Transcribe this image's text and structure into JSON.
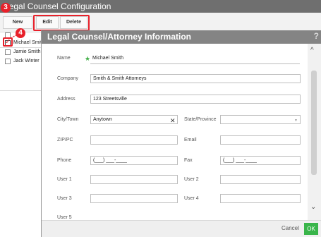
{
  "background": {
    "window_title": "Legal Counsel Configuration",
    "toolbar": {
      "new_label": "New",
      "edit_label": "Edit",
      "delete_label": "Delete"
    },
    "step_badges": [
      "3",
      "4"
    ],
    "rows": [
      {
        "name": "",
        "checked": false
      },
      {
        "name": "Michael Smith",
        "checked": true
      },
      {
        "name": "Jamie Smith",
        "checked": false
      },
      {
        "name": "Jack Winter",
        "checked": false
      }
    ]
  },
  "modal": {
    "title": "Legal Counsel/Attorney Information",
    "help_icon": "?",
    "fields": {
      "name": {
        "label": "Name",
        "value": "Michael Smith",
        "required_icon": "★"
      },
      "company": {
        "label": "Company",
        "value": "Smith & Smith Attorneys"
      },
      "address": {
        "label": "Address",
        "value": "123 Streetsville"
      },
      "city": {
        "label": "City/Town",
        "value": "Anytown",
        "clear_icon": "✕"
      },
      "state": {
        "label": "State/Province",
        "value": ""
      },
      "zip": {
        "label": "ZIP/PC",
        "value": ""
      },
      "email": {
        "label": "Email",
        "value": ""
      },
      "phone": {
        "label": "Phone",
        "value": "(___) ___-____"
      },
      "fax": {
        "label": "Fax",
        "value": "(___) ___-____"
      },
      "user1": {
        "label": "User 1",
        "value": ""
      },
      "user2": {
        "label": "User 2",
        "value": ""
      },
      "user3": {
        "label": "User 3",
        "value": ""
      },
      "user4": {
        "label": "User 4",
        "value": ""
      },
      "user5": {
        "label": "User 5"
      }
    },
    "footer": {
      "cancel_label": "Cancel",
      "ok_label": "OK"
    }
  },
  "colors": {
    "highlight": "#e8202a",
    "ok_green": "#39b54a",
    "required_star": "#44b04a",
    "header_gray": "#848484"
  },
  "icons": {
    "required": "star-icon",
    "clear": "close-icon",
    "help": "question-icon",
    "dropdown": "chevron-down-icon",
    "check": "checkmark-icon"
  }
}
